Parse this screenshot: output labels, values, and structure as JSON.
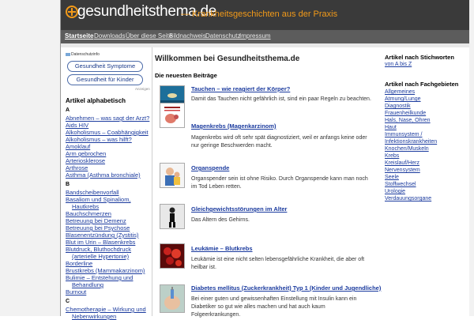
{
  "header": {
    "logo": "gesundheitsthema.de",
    "tagline": "— Krankheitsgeschichten aus der Praxis"
  },
  "nav": [
    "Startseite",
    "Downloads",
    "Über diese Seite",
    "Bildnachweis",
    "Datenschutz",
    "Impressum"
  ],
  "left": {
    "privacy_badge": "Datenschutzinfo",
    "buttons": [
      "Gesundheit Symptome",
      "Gesundheit für Kinder"
    ],
    "ads_label": "Anzeigen",
    "heading": "Artikel alphabetisch",
    "letters": [
      "A",
      "B",
      "C"
    ],
    "links_a": [
      "Abnehmen – was sagt der Arzt?",
      "Aids HIV",
      "Alkoholismus – Coabhängigkeit",
      "Alkoholismus – was hilft?",
      "Amoklauf",
      "Arm gebrochen",
      "Arteriosklerose",
      "Arthrose",
      "Asthma (Asthma bronchiale)"
    ],
    "links_b": [
      "Bandscheibenvorfall",
      "Basaliom und Spinaliom,",
      "Hautkrebs",
      "Bauchschmerzen",
      "Betreuung bei Demenz",
      "Betreuung bei Psychose",
      "Blasenentzündung (Zystitis)",
      "Blut im Urin – Blasenkrebs",
      "Blutdruck, Bluthochdruck",
      "(arterielle Hypertonie)",
      "Borderline",
      "Brustkrebs (Mammakarzinom)",
      "Bulimie – Entstehung und",
      "Behandlung",
      "Burnout"
    ],
    "links_c": [
      "Chemotherapie – Wirkung und",
      "Nebenwirkungen"
    ]
  },
  "main": {
    "welcome": "Willkommen bei Gesundheitsthema.de",
    "latest_heading": "Die neuesten Beiträge",
    "posts": [
      {
        "title": "Tauchen – wie reagiert der Körper?",
        "text": "Damit das Tauchen nicht gefährlich ist, sind ein paar Regeln zu beachten."
      },
      {
        "title": "Magenkrebs (Magenkarzinom)",
        "text": "Magenkrebs wird oft sehr spät diagnostiziert, weil er anfangs keine oder nur geringe Beschwerden macht."
      },
      {
        "title": "Organspende",
        "text": "Organspender sein ist ohne Risiko. Durch Organspende kann man noch im Tod Leben retten."
      },
      {
        "title": "Gleichgewichtsstörungen im Alter",
        "text": "Das Altern des Gehirns."
      },
      {
        "title": "Leukämie – Blutkrebs",
        "text": "Leukämie ist eine nicht selten lebensgefährliche Krankheit, die aber oft heilbar ist."
      },
      {
        "title": "Diabetes mellitus (Zuckerkrankheit) Typ 1 (Kinder und Jugendliche)",
        "text": "Bei einer guten und gewissenhaften Einstellung mit Insulin kann ein Diabetiker so gut wie alles machen und hat auch kaum Folgeerkrankungen."
      }
    ]
  },
  "right": {
    "keywords_heading": "Artikel nach Stichworten",
    "keywords_link": "von A bis Z",
    "topics_heading": "Artikel nach Fachgebieten",
    "topics": [
      "Allgemeines",
      "Atmung/Lunge",
      "Diagnostik",
      "Frauenheilkunde",
      "Hals, Nase, Ohren",
      "Haut",
      "Immunsystem /",
      "Infektionskrankheiten",
      "Knochen/Muskeln",
      "Krebs",
      "Kreislauf/Herz",
      "Nervensystem",
      "Seele",
      "Stoffwechsel",
      "Urologie",
      "Verdauungsorgane"
    ]
  },
  "colors": {
    "header_bg": "#3a3a3a",
    "accent": "#f29a19",
    "link": "#1a3a9e"
  }
}
